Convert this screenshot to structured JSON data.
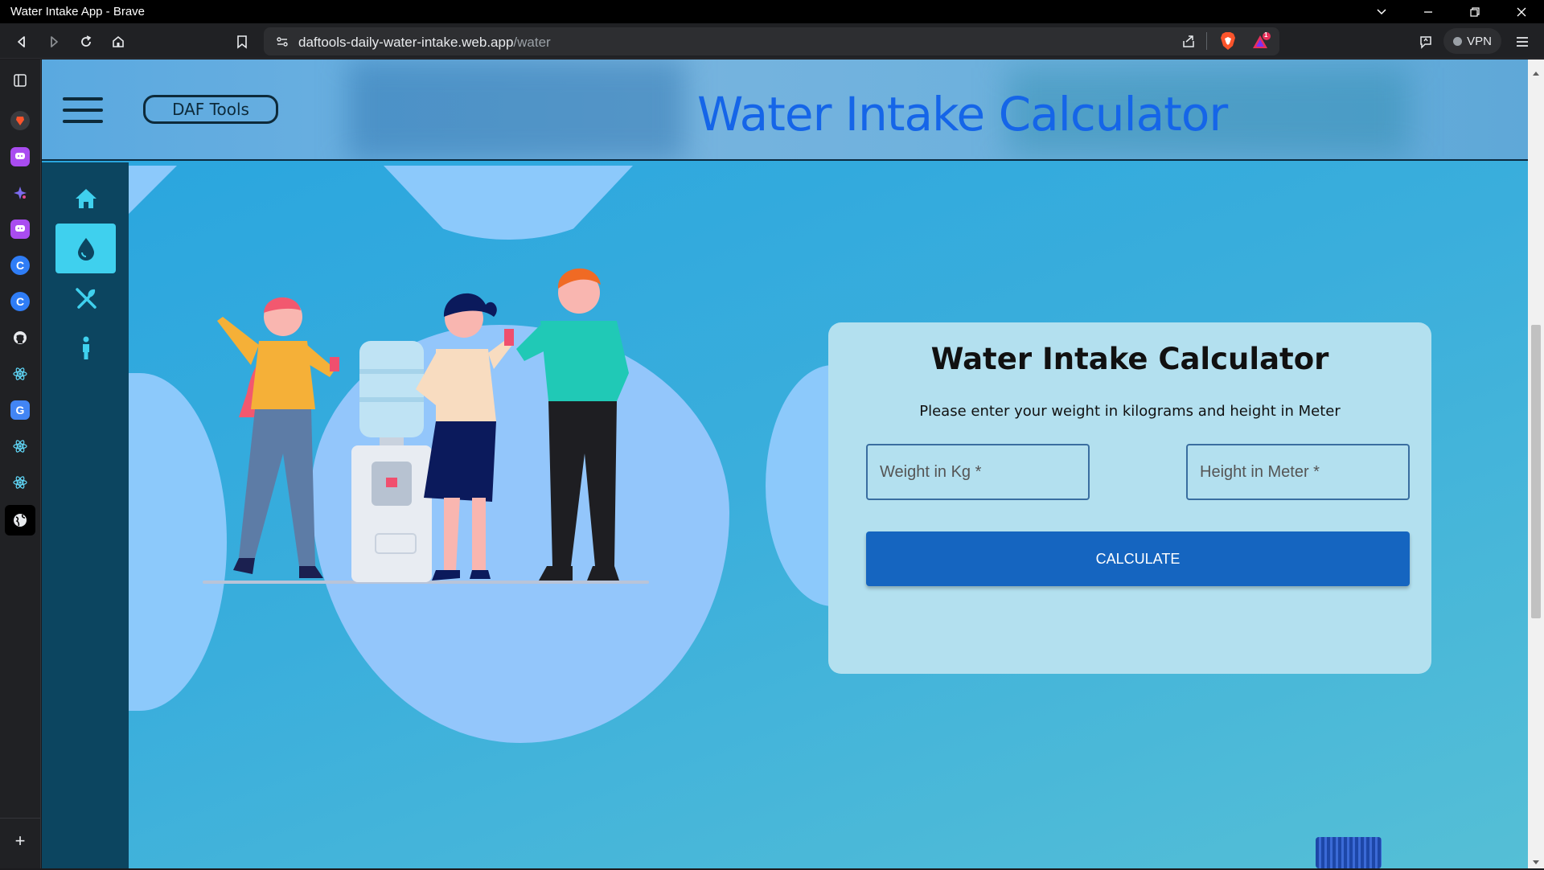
{
  "window": {
    "title": "Water Intake App - Brave"
  },
  "browser": {
    "url_host": "daftools-daily-water-intake.web.app",
    "url_path": "/water",
    "vpn_label": "VPN",
    "notification_count": "1",
    "side_panel_add": "+"
  },
  "header": {
    "brand": "DAF Tools",
    "title": "Water Intake Calculator"
  },
  "nav": {
    "items": [
      "home",
      "water",
      "food",
      "person"
    ],
    "active": "water"
  },
  "card": {
    "title": "Water Intake Calculator",
    "subtitle": "Please enter your weight in kilograms and height in Meter",
    "weight_placeholder": "Weight in Kg *",
    "height_placeholder": "Height in Meter *",
    "button_label": "CALCULATE"
  },
  "colors": {
    "accent_blue": "#1565c0",
    "title_blue": "#1565e8",
    "nav_bg": "#0c4560",
    "nav_active": "#3fd0ee",
    "card_bg": "#b3e0ef"
  }
}
